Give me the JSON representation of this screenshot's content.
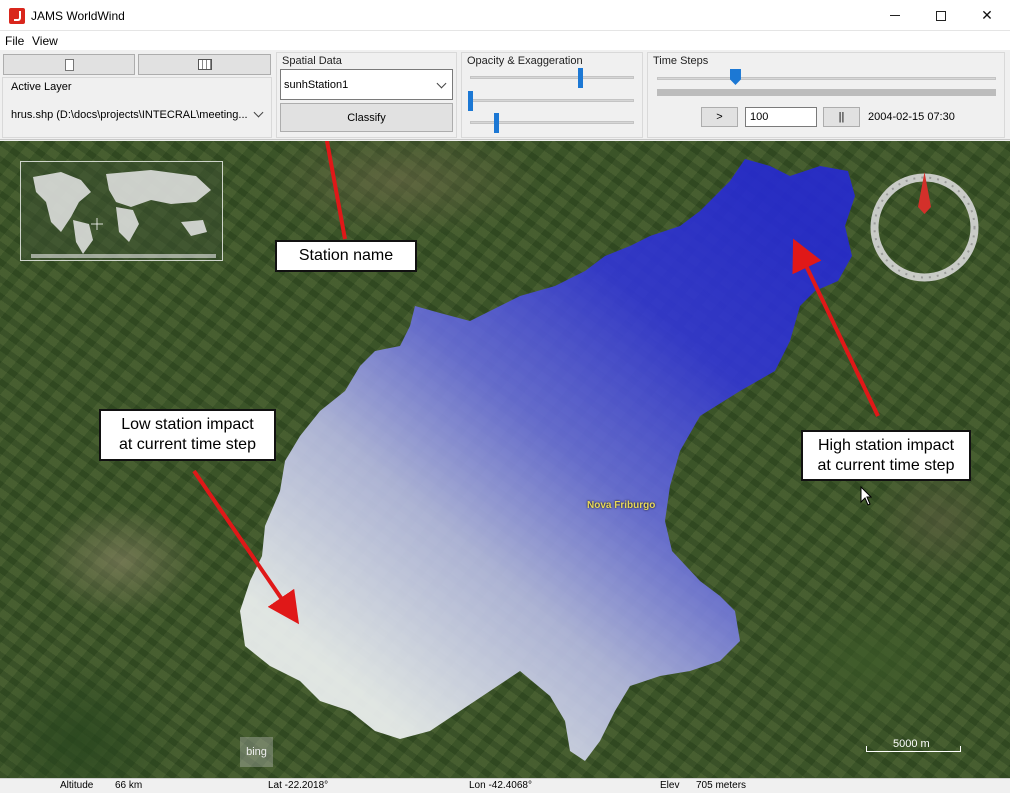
{
  "window": {
    "title": "JAMS WorldWind"
  },
  "menu": {
    "items": [
      "File",
      "View"
    ]
  },
  "toolbar": {
    "active_layer": {
      "title": "Active Layer",
      "value": "hrus.shp (D:\\docs\\projects\\INTECRAL\\meeting..."
    },
    "spatial_data": {
      "title": "Spatial Data",
      "selected": "sunhStation1",
      "classify_label": "Classify"
    },
    "opacity": {
      "title": "Opacity & Exaggeration",
      "slider1": 0.68,
      "slider2": 0.0,
      "slider3": 0.16
    },
    "time_steps": {
      "title": "Time Steps",
      "position": 0.23,
      "play_label": ">",
      "step_value": "100",
      "pause_label": "||",
      "timestamp": "2004-02-15 07:30"
    }
  },
  "map": {
    "town_label": "Nova Friburgo",
    "bing_label": "bing",
    "scale_label": "5000 m",
    "callouts": {
      "station": "Station name",
      "low_line1": "Low station impact",
      "low_line2": "at current time step",
      "high_line1": "High station impact",
      "high_line2": "at current time step"
    },
    "colors": {
      "high_impact": "#2a2fd0",
      "low_impact": "#e8eef0",
      "arrow": "#e01818"
    }
  },
  "status": {
    "altitude_label": "Altitude",
    "altitude_value": "66 km",
    "lat": "Lat -22.2018°",
    "lon": "Lon -42.4068°",
    "elev_label": "Elev",
    "elev_value": "705 meters"
  }
}
